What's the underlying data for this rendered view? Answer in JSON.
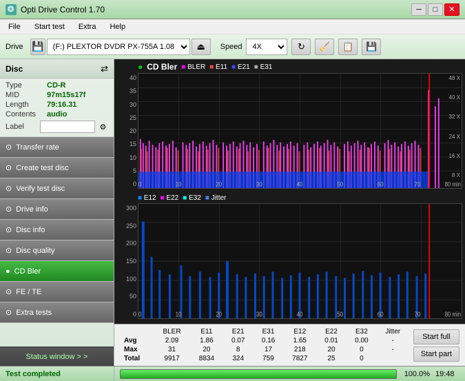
{
  "titlebar": {
    "icon": "💿",
    "title": "Opti Drive Control 1.70",
    "min": "─",
    "max": "□",
    "close": "✕"
  },
  "menubar": {
    "items": [
      "File",
      "Start test",
      "Extra",
      "Help"
    ]
  },
  "toolbar": {
    "drive_label": "Drive",
    "drive_value": "(F:) PLEXTOR DVDR  PX-755A 1.08",
    "speed_label": "Speed",
    "speed_value": "4X"
  },
  "sidebar": {
    "disc_title": "Disc",
    "disc_info": {
      "type_label": "Type",
      "type_value": "CD-R",
      "mid_label": "MID",
      "mid_value": "97m15s17f",
      "length_label": "Length",
      "length_value": "79:16.31",
      "contents_label": "Contents",
      "contents_value": "audio",
      "label_label": "Label",
      "label_value": ""
    },
    "nav_items": [
      {
        "id": "transfer-rate",
        "label": "Transfer rate",
        "active": false
      },
      {
        "id": "create-test-disc",
        "label": "Create test disc",
        "active": false
      },
      {
        "id": "verify-test-disc",
        "label": "Verify test disc",
        "active": false
      },
      {
        "id": "drive-info",
        "label": "Drive info",
        "active": false
      },
      {
        "id": "disc-info",
        "label": "Disc info",
        "active": false
      },
      {
        "id": "disc-quality",
        "label": "Disc quality",
        "active": false
      },
      {
        "id": "cd-bler",
        "label": "CD Bler",
        "active": true
      }
    ],
    "fe_te": "FE / TE",
    "extra_tests": "Extra tests",
    "status_window": "Status window > >"
  },
  "chart1": {
    "title": "CD Bler",
    "icon": "●",
    "legend": [
      {
        "label": "BLER",
        "color": "#ff00ff"
      },
      {
        "label": "E11",
        "color": "#ff4444"
      },
      {
        "label": "E21",
        "color": "#4444ff"
      },
      {
        "label": "E31",
        "color": "#888888"
      }
    ],
    "y_max": 40,
    "y_labels": [
      "40",
      "35",
      "30",
      "25",
      "20",
      "15",
      "10",
      "5",
      "0"
    ],
    "x_labels": [
      "0",
      "10",
      "20",
      "30",
      "40",
      "50",
      "60",
      "70",
      "80 min"
    ],
    "right_y_labels": [
      "48 X",
      "40 X",
      "32 X",
      "24 X",
      "16 X",
      "8 X"
    ]
  },
  "chart2": {
    "legend": [
      {
        "label": "E12",
        "color": "#0088ff"
      },
      {
        "label": "E22",
        "color": "#ff00ff"
      },
      {
        "label": "E32",
        "color": "#00ffff"
      },
      {
        "label": "Jitter",
        "color": "#4488ff"
      }
    ],
    "y_max": 300,
    "y_labels": [
      "300",
      "250",
      "200",
      "150",
      "100",
      "50",
      "0"
    ],
    "x_labels": [
      "0",
      "10",
      "20",
      "30",
      "40",
      "50",
      "60",
      "70",
      "80 min"
    ]
  },
  "stats": {
    "headers": [
      "",
      "BLER",
      "E11",
      "E21",
      "E31",
      "E12",
      "E22",
      "E32",
      "Jitter"
    ],
    "rows": [
      {
        "label": "Avg",
        "values": [
          "2.09",
          "1.86",
          "0.07",
          "0.16",
          "1.65",
          "0.01",
          "0.00",
          "-"
        ]
      },
      {
        "label": "Max",
        "values": [
          "31",
          "20",
          "8",
          "17",
          "218",
          "20",
          "0",
          "-"
        ]
      },
      {
        "label": "Total",
        "values": [
          "9917",
          "8834",
          "324",
          "759",
          "7827",
          "25",
          "0",
          ""
        ]
      }
    ],
    "start_full": "Start full",
    "start_part": "Start part"
  },
  "statusbar": {
    "status_text": "Test completed",
    "progress_pct": "100.0%",
    "time": "19:48"
  }
}
